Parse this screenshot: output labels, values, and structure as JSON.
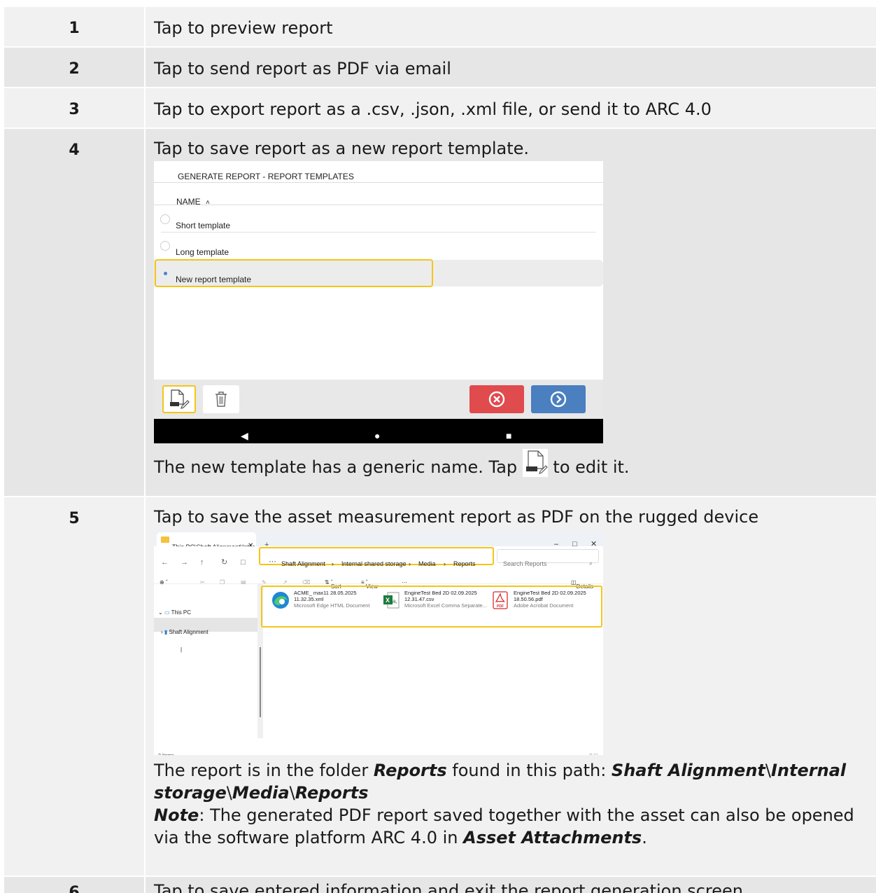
{
  "rows": [
    {
      "num": "1",
      "text": "Tap to preview report"
    },
    {
      "num": "2",
      "text": "Tap to send report as PDF via email"
    },
    {
      "num": "3",
      "text": "Tap to export report as a .csv, .json, .xml file, or send it to ARC 4.0"
    },
    {
      "num": "4",
      "text": "Tap to save report as a new report template.",
      "after_before_icon": "The new template has a generic name. Tap ",
      "after_after_icon": " to edit it."
    },
    {
      "num": "5",
      "text": "Tap to save the asset measurement report as PDF on the rugged device",
      "p1_a": "The report is in the folder ",
      "p1_b": "Reports",
      "p1_c": " found in this path: ",
      "p1_d": "Shaft Alignment",
      "p1_e": "\\",
      "p1_f": "Internal storage",
      "p1_g": "\\",
      "p1_h": "Media",
      "p1_i": "\\",
      "p1_j": "Reports",
      "p2_a": "Note",
      "p2_b": ": The generated PDF report saved together with the asset can also be opened via the software platform ARC 4.0 in ",
      "p2_c": "Asset Attachments",
      "p2_d": "."
    },
    {
      "num": "6",
      "text": "Tap to save entered information and exit the report generation screen"
    }
  ],
  "templates_screen": {
    "title": "GENERATE REPORT - REPORT TEMPLATES",
    "column_header": "NAME",
    "sort_icon": "chevron-up-icon",
    "items": [
      "Short template",
      "Long template",
      "New report template"
    ],
    "selected_index": 2,
    "edit_icon_text": "NAME",
    "highlight_color": "#f5c518",
    "cancel_color": "#e04b4e",
    "next_color": "#4a7fc0"
  },
  "explorer": {
    "tab_title": "This PC\\Shaft Alignment\\Inter",
    "breadcrumb": [
      "Shaft Alignment",
      "Internal shared storage",
      "Media",
      "Reports"
    ],
    "search_placeholder": "Search Reports",
    "commands": [
      "New",
      "Sort",
      "View",
      "Details"
    ],
    "sidebar": [
      "This PC",
      "Shaft Alignment"
    ],
    "files": [
      {
        "name": "ACME_ max11 28.05.2025",
        "name2": "11.32.35.xml",
        "type": "Microsoft Edge HTML Document"
      },
      {
        "name": "EngineTest Bed 2D 02.09.2025",
        "name2": "12.31.47.csv",
        "type": "Microsoft Excel Comma Separate..."
      },
      {
        "name": "EngineTest Bed 2D 02.09.2025",
        "name2": "18.50.56.pdf",
        "type": "Adobe Acrobat Document"
      }
    ],
    "status": "3 items"
  }
}
